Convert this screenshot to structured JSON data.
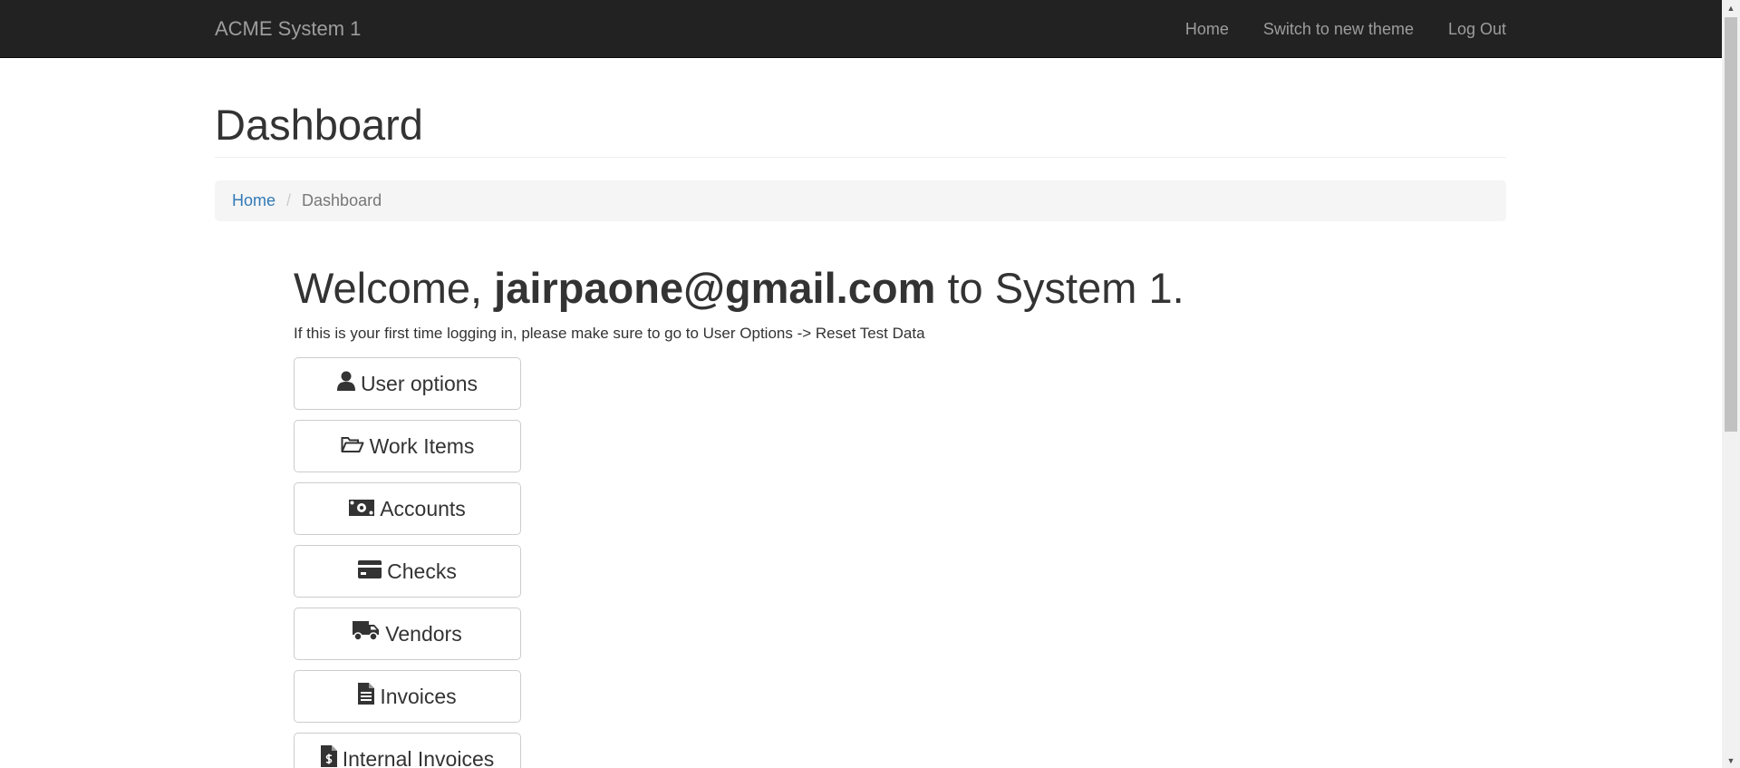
{
  "navbar": {
    "brand": "ACME System 1",
    "links": [
      "Home",
      "Switch to new theme",
      "Log Out"
    ]
  },
  "page": {
    "title": "Dashboard"
  },
  "breadcrumb": {
    "home": "Home",
    "separator": "/",
    "current": "Dashboard"
  },
  "welcome": {
    "prefix": "Welcome, ",
    "user": "jairpaone@gmail.com",
    "suffix": " to System 1.",
    "note": "If this is your first time logging in, please make sure to go to User Options -> Reset Test Data"
  },
  "menu": [
    {
      "label": "User options",
      "icon": "user-icon"
    },
    {
      "label": "Work Items",
      "icon": "folder-open-icon"
    },
    {
      "label": "Accounts",
      "icon": "money-icon"
    },
    {
      "label": "Checks",
      "icon": "credit-card-icon"
    },
    {
      "label": "Vendors",
      "icon": "truck-icon"
    },
    {
      "label": "Invoices",
      "icon": "file-text-icon"
    },
    {
      "label": "Internal Invoices",
      "icon": "file-invoice-dollar-icon"
    }
  ],
  "colors": {
    "navbar_bg": "#222222",
    "nav_text": "#9d9d9d",
    "link": "#337ab7",
    "breadcrumb_bg": "#f5f5f5"
  }
}
